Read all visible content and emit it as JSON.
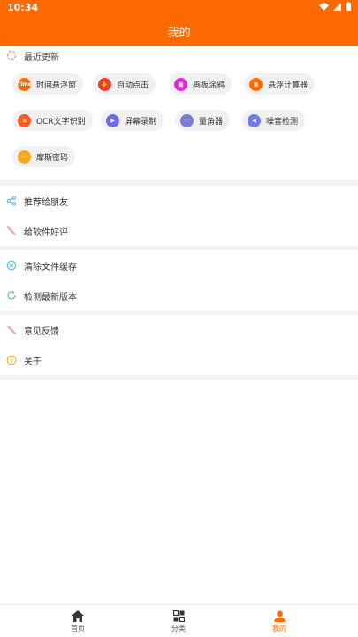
{
  "status": {
    "time": "10:34"
  },
  "header": {
    "title": "我的"
  },
  "recent": {
    "label": "最近更新",
    "items": [
      {
        "label": "时间悬浮窗",
        "icon": "time-float-icon",
        "color": "#ff6a00",
        "glyph": "Time"
      },
      {
        "label": "自动点击",
        "icon": "auto-click-icon",
        "color": "#ee3b2b",
        "glyph": "✋"
      },
      {
        "label": "画板涂鸦",
        "icon": "drawing-board-icon",
        "color": "#e327d6",
        "glyph": "画"
      },
      {
        "label": "悬浮计算器",
        "icon": "calculator-icon",
        "color": "#ff6a00",
        "glyph": "▦"
      },
      {
        "label": "OCR文字识别",
        "icon": "ocr-icon",
        "color": "#ff5a1f",
        "glyph": "≡"
      },
      {
        "label": "屏幕录制",
        "icon": "screen-record-icon",
        "color": "#6c6cf0",
        "glyph": "▶"
      },
      {
        "label": "量角器",
        "icon": "protractor-icon",
        "color": "#7b7bd8",
        "glyph": "◠"
      },
      {
        "label": "噪音检测",
        "icon": "noise-detect-icon",
        "color": "#6c7ef0",
        "glyph": "◀"
      },
      {
        "label": "摩斯密码",
        "icon": "morse-code-icon",
        "color": "#f7a81b",
        "glyph": "···"
      }
    ]
  },
  "menu": [
    {
      "label": "推荐给朋友",
      "icon": "share-icon"
    },
    {
      "label": "给软件好评",
      "icon": "pencil-icon"
    },
    {
      "label": "清除文件缓存",
      "icon": "clear-cache-icon"
    },
    {
      "label": "检测最新版本",
      "icon": "refresh-icon"
    },
    {
      "label": "意见反馈",
      "icon": "feedback-pencil-icon"
    },
    {
      "label": "关于",
      "icon": "info-icon"
    }
  ],
  "tabs": [
    {
      "label": "首页",
      "icon": "home-icon"
    },
    {
      "label": "分类",
      "icon": "category-icon"
    },
    {
      "label": "我的",
      "icon": "user-icon"
    }
  ],
  "colors": {
    "accent": "#ff6a00",
    "gap": "#f2f2f2"
  }
}
